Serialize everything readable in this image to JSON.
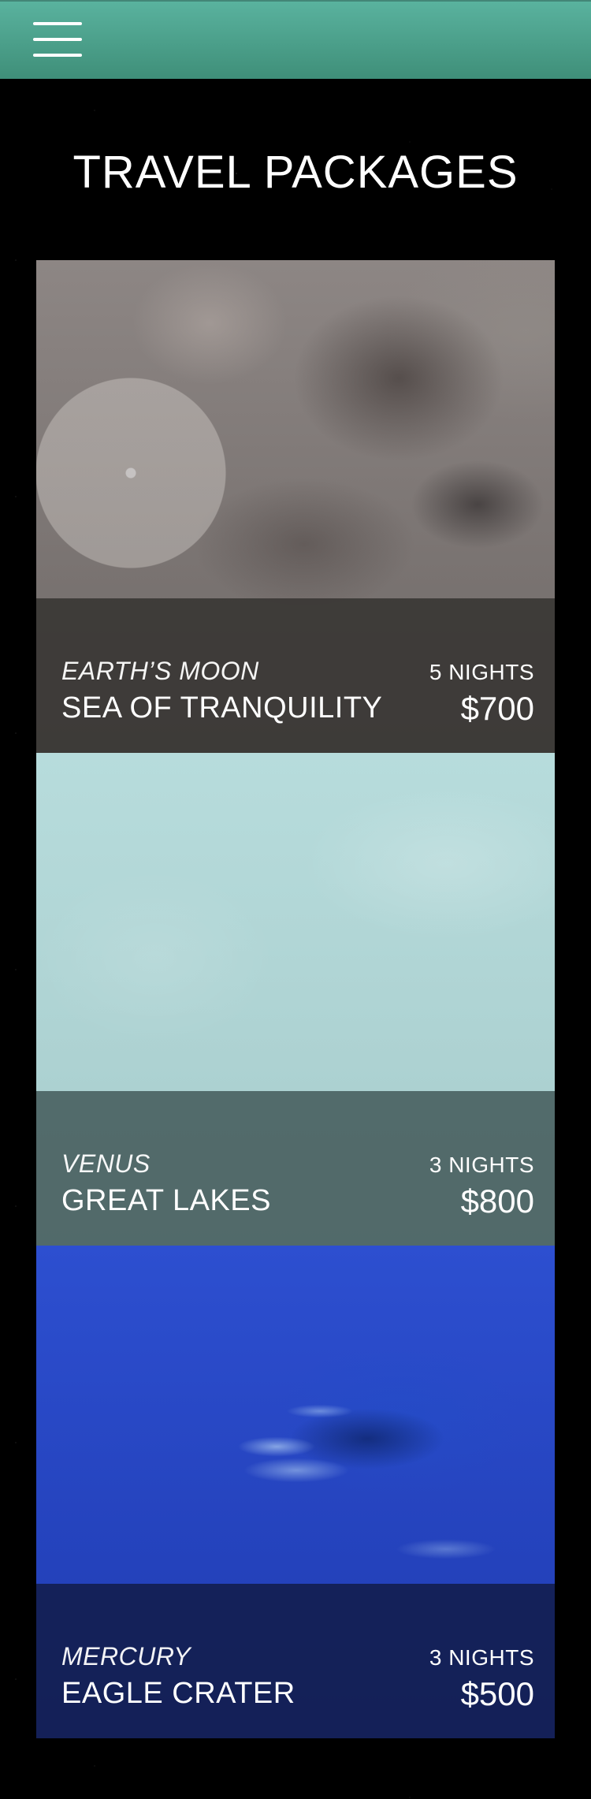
{
  "header": {
    "menu_icon": "hamburger-menu-icon",
    "background_color": "#4aa28b"
  },
  "page": {
    "title": "TRAVEL PACKAGES"
  },
  "packages": [
    {
      "destination": "EARTH’S MOON",
      "name": "SEA OF TRANQUILITY",
      "nights": "5 NIGHTS",
      "price": "$700"
    },
    {
      "destination": "VENUS",
      "name": "GREAT LAKES",
      "nights": "3 NIGHTS",
      "price": "$800"
    },
    {
      "destination": "MERCURY",
      "name": "EAGLE CRATER",
      "nights": "3 NIGHTS",
      "price": "$500"
    }
  ]
}
